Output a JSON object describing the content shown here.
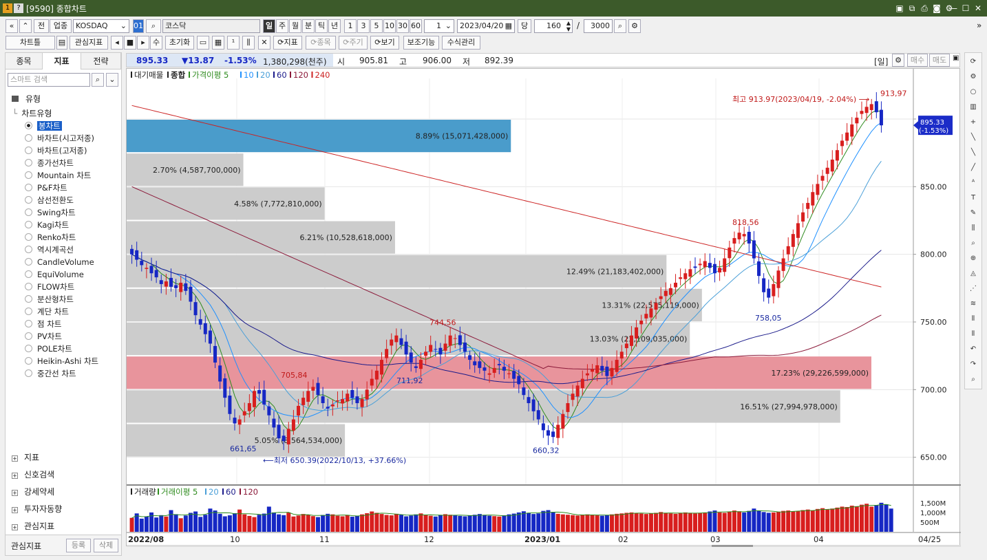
{
  "window": {
    "title": "[9590] 종합차트",
    "left_icons": [
      "1",
      "?"
    ],
    "controls": [
      "window-tile-icon",
      "copy-icon",
      "print-icon",
      "camera-icon",
      "settings-icon",
      "minimize-icon",
      "maximize-icon",
      "close-icon"
    ]
  },
  "toolbar1": {
    "prev": "«",
    "up": "⌃",
    "jeon": "전",
    "sector": "업종",
    "market": "KOSDAQ",
    "code_btn": "01",
    "market_name": "코스닥",
    "periods": [
      "일",
      "주",
      "월",
      "분",
      "틱",
      "년"
    ],
    "period_active": "일",
    "intervals": [
      "1",
      "3",
      "5",
      "10",
      "30",
      "60"
    ],
    "interval_value": "1",
    "date": "2023/04/20",
    "dang": "당",
    "count": "160",
    "slash": "/",
    "total": "3000"
  },
  "toolbar2": {
    "chart_style": "차트틀",
    "watch": "관심지표",
    "su": "수",
    "reset": "초기화",
    "indicator": "⟳지표",
    "item": "⟳종목",
    "period": "⟳주기",
    "view": "⟳보기",
    "assist": "보조기능",
    "formula": "수식관리"
  },
  "left": {
    "tabs": [
      "종목",
      "지표",
      "전략"
    ],
    "active_tab": "지표",
    "search_placeholder": "스마트 검색",
    "section": "유형",
    "tree_root": "차트유형",
    "chart_types": [
      "봉차트",
      "바차트(시고저종)",
      "바차트(고저종)",
      "종가선차트",
      "Mountain 차트",
      "P&F차트",
      "삼선전환도",
      "Swing차트",
      "Kagi차트",
      "Renko차트",
      "역시계곡선",
      "CandleVolume",
      "EquiVolume",
      "FLOW차트",
      "분산형차트",
      "계단 차트",
      "점 차트",
      "PV차트",
      "POLE차트",
      "Heikin-Ashi 차트",
      "중간선 차트"
    ],
    "selected": "봉차트",
    "accordion": [
      "지표",
      "신호검색",
      "강세약세",
      "투자자동향",
      "관심지표"
    ],
    "footer": {
      "label": "관심지표",
      "register": "등록",
      "delete": "삭제"
    }
  },
  "quote": {
    "price": "895.33",
    "change": "▼13.87",
    "rate": "-1.53%",
    "volume": "1,380,298(천주)",
    "open_label": "시",
    "open": "905.81",
    "high_label": "고",
    "high": "906.00",
    "low_label": "저",
    "low": "892.39",
    "period_tag": "[일]",
    "buy": "매수",
    "sell": "매도"
  },
  "legend": {
    "price": [
      "대기매물",
      "종합",
      "가격이평 5",
      "10",
      "20",
      "60",
      "120",
      "240"
    ],
    "volume": [
      "거래량",
      "거래이평 5",
      "20",
      "60",
      "120"
    ]
  },
  "colors": {
    "up": "#d81e1e",
    "down": "#1627c4",
    "ma5": "#2e8b1e",
    "ma10": "#1e90ff",
    "ma20": "#4a9fd8",
    "ma60": "#1a1a8a",
    "ma120": "#8b1a3a",
    "ma240": "#cc2222",
    "vp_blue": "#4a9ccb",
    "vp_red": "#e8949c",
    "vp_gray": "#cccccc",
    "selection": "#1a5fc8",
    "titlebar": "#3c5a2a"
  },
  "chart_data": {
    "type": "candlestick",
    "ylim": [
      630,
      930
    ],
    "y_ticks": [
      "900.00",
      "850.00",
      "800.00",
      "750.00",
      "700.00",
      "650.00"
    ],
    "y_tick_values": [
      900,
      850,
      800,
      750,
      700,
      650
    ],
    "x_labels": [
      "2022/08",
      "10",
      "11",
      "12",
      "2023/01",
      "02",
      "03",
      "04",
      "04/25"
    ],
    "volume_ticks": [
      "1,500M",
      "1,000M",
      "500M"
    ],
    "last_price_tag": [
      "895.33",
      "(-1.53%)"
    ],
    "high_note": "최고 913.97(2023/04/19, -2.04%)",
    "low_note": "최저 650.39(2022/10/13, +37.66%)",
    "point_labels": [
      {
        "text": "913.97",
        "v": 913.97
      },
      {
        "text": "818.56",
        "v": 818.56
      },
      {
        "text": "758.05",
        "v": 758.05
      },
      {
        "text": "744.56",
        "v": 744.56
      },
      {
        "text": "711.92",
        "v": 711.92
      },
      {
        "text": "705.84",
        "v": 705.84
      },
      {
        "text": "661.65",
        "v": 661.65
      },
      {
        "text": "660.32",
        "v": 660.32
      }
    ],
    "volume_profile": [
      {
        "label": "8.89% (15,071,428,000)",
        "pct": 8.89,
        "lo": 875,
        "hi": 900,
        "color": "blue"
      },
      {
        "label": "2.70% (4,587,700,000)",
        "pct": 2.7,
        "lo": 850,
        "hi": 875
      },
      {
        "label": "4.58% (7,772,810,000)",
        "pct": 4.58,
        "lo": 825,
        "hi": 850
      },
      {
        "label": "6.21% (10,528,618,000)",
        "pct": 6.21,
        "lo": 800,
        "hi": 825
      },
      {
        "label": "12.49% (21,183,402,000)",
        "pct": 12.49,
        "lo": 775,
        "hi": 800
      },
      {
        "label": "13.31% (22,575,119,000)",
        "pct": 13.31,
        "lo": 750,
        "hi": 775
      },
      {
        "label": "13.03% (22,109,035,000)",
        "pct": 13.03,
        "lo": 725,
        "hi": 750
      },
      {
        "label": "17.23% (29,226,599,000)",
        "pct": 17.23,
        "lo": 700,
        "hi": 725,
        "color": "red"
      },
      {
        "label": "16.51% (27,994,978,000)",
        "pct": 16.51,
        "lo": 675,
        "hi": 700
      },
      {
        "label": "5.05% (8,564,534,000)",
        "pct": 5.05,
        "lo": 650,
        "hi": 675
      }
    ],
    "close_series": [
      800,
      796,
      792,
      790,
      786,
      783,
      778,
      780,
      776,
      775,
      779,
      773,
      765,
      755,
      748,
      741,
      734,
      720,
      706,
      694,
      682,
      675,
      678,
      684,
      690,
      699,
      697,
      689,
      681,
      672,
      664,
      662,
      671,
      678,
      688,
      694,
      699,
      702,
      696,
      690,
      686,
      689,
      692,
      693,
      697,
      694,
      690,
      693,
      700,
      708,
      714,
      722,
      730,
      737,
      740,
      733,
      726,
      720,
      716,
      722,
      728,
      733,
      730,
      726,
      734,
      740,
      738,
      733,
      728,
      722,
      718,
      716,
      714,
      712,
      716,
      718,
      714,
      712,
      708,
      704,
      696,
      690,
      684,
      678,
      670,
      666,
      665,
      674,
      682,
      690,
      697,
      703,
      708,
      712,
      715,
      718,
      714,
      710,
      716,
      722,
      728,
      734,
      740,
      746,
      751,
      756,
      760,
      764,
      769,
      773,
      775,
      779,
      783,
      786,
      789,
      790,
      793,
      795,
      790,
      786,
      790,
      797,
      805,
      812,
      816,
      815,
      808,
      797,
      784,
      772,
      768,
      778,
      788,
      797,
      806,
      815,
      823,
      831,
      838,
      846,
      852,
      858,
      864,
      870,
      877,
      884,
      890,
      896,
      901,
      906,
      909,
      911,
      905,
      895.33
    ],
    "volume_series": [
      0.72,
      0.95,
      0.68,
      0.8,
      1.0,
      0.74,
      0.86,
      0.79,
      1.12,
      0.91,
      0.7,
      0.84,
      0.98,
      1.05,
      0.77,
      0.88,
      1.2,
      1.1,
      0.93,
      0.8,
      0.85,
      0.96,
      1.15,
      0.9,
      0.82,
      0.76,
      0.88,
      0.94,
      1.3,
      1.0,
      0.9,
      0.86,
      0.99,
      0.79,
      0.84,
      0.92,
      0.88,
      0.81,
      0.76,
      0.87,
      0.93,
      0.9,
      0.83,
      0.8,
      0.86,
      0.78,
      0.82,
      0.9,
      0.96,
      1.05,
      0.98,
      0.92,
      0.87,
      0.85,
      0.93,
      0.88,
      0.8,
      0.84,
      0.9,
      0.95,
      0.87,
      0.83,
      0.79,
      0.86,
      0.91,
      0.88,
      0.85,
      0.82,
      0.8,
      0.84,
      0.88,
      0.92,
      0.86,
      0.83,
      0.81,
      0.79,
      0.85,
      0.9,
      0.94,
      1.0,
      1.06,
      0.97,
      0.92,
      0.95,
      1.08,
      1.12,
      1.0,
      0.93,
      0.9,
      0.88,
      0.86,
      0.84,
      0.87,
      0.9,
      0.88,
      0.85,
      0.83,
      0.86,
      0.9,
      0.93,
      0.95,
      0.98,
      1.0,
      0.96,
      0.94,
      0.92,
      0.95,
      0.98,
      1.02,
      0.97,
      0.95,
      0.93,
      0.96,
      1.0,
      0.98,
      0.95,
      0.97,
      1.0,
      1.05,
      1.1,
      1.0,
      0.98,
      1.04,
      1.1,
      1.06,
      1.0,
      1.08,
      1.2,
      1.1,
      1.02,
      0.98,
      1.0,
      1.04,
      1.08,
      1.1,
      1.05,
      1.08,
      1.12,
      1.15,
      1.1,
      1.18,
      1.22,
      1.15,
      1.2,
      1.25,
      1.3,
      1.28,
      1.35,
      1.32,
      1.4,
      1.45,
      1.3,
      1.38,
      1.5,
      1.42,
      1.2
    ]
  }
}
